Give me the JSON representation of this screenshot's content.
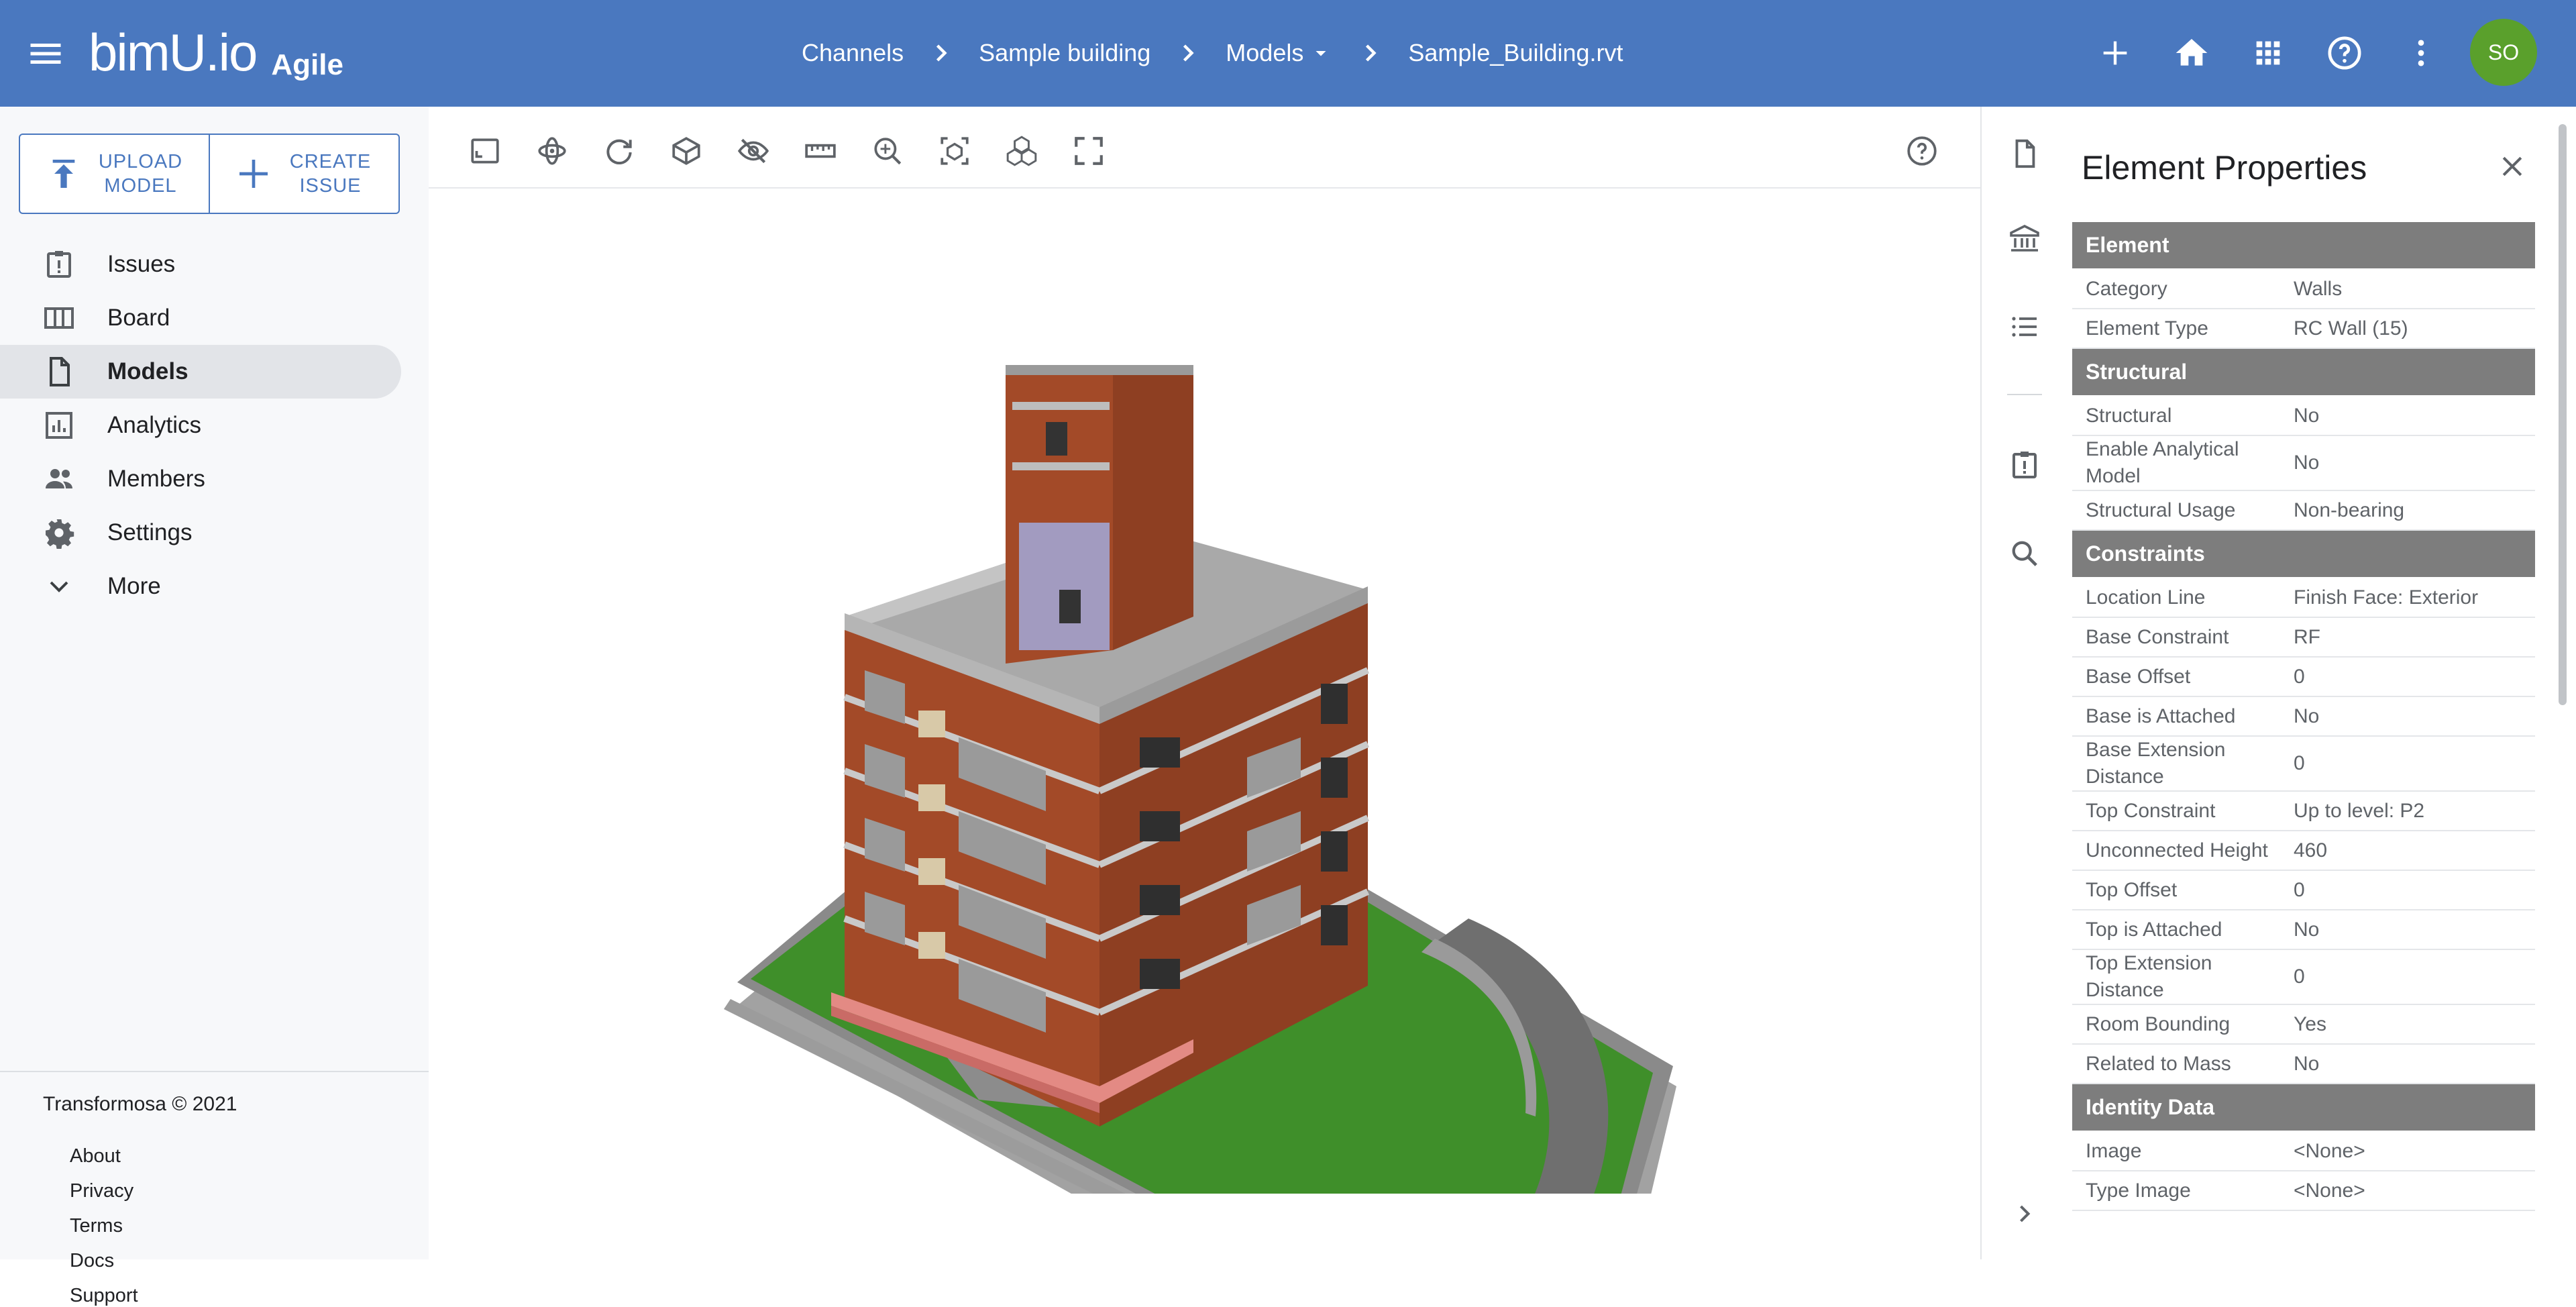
{
  "app": {
    "logo": "bimU.io",
    "edition": "Agile"
  },
  "header": {
    "breadcrumbs": [
      {
        "label": "Channels"
      },
      {
        "label": "Sample building"
      },
      {
        "label": "Models"
      },
      {
        "label": "Sample_Building.rvt"
      }
    ],
    "icons": [
      "add-icon",
      "home-icon",
      "apps-grid-icon",
      "help-icon",
      "more-vert-icon"
    ],
    "avatar_initials": "SO"
  },
  "sidebar": {
    "upload_label": "UPLOAD MODEL",
    "create_issue_label": "CREATE ISSUE",
    "items": [
      {
        "label": "Issues",
        "icon": "issue-icon"
      },
      {
        "label": "Board",
        "icon": "board-icon"
      },
      {
        "label": "Models",
        "icon": "document-icon",
        "active": true
      },
      {
        "label": "Analytics",
        "icon": "analytics-icon"
      },
      {
        "label": "Members",
        "icon": "members-icon"
      },
      {
        "label": "Settings",
        "icon": "gear-icon"
      },
      {
        "label": "More",
        "icon": "chevron-down-icon"
      }
    ],
    "copyright": "Transformosa © 2021",
    "footer_links": [
      "About",
      "Privacy",
      "Terms",
      "Docs",
      "Support"
    ]
  },
  "viewer": {
    "tools": [
      "fit-view-icon",
      "orbit-icon",
      "reset-view-icon",
      "section-box-icon",
      "hide-icon",
      "measure-icon",
      "zoom-icon",
      "isolate-icon",
      "layers-icon",
      "fullscreen-icon"
    ]
  },
  "properties": {
    "title": "Element Properties",
    "sections": [
      {
        "name": "Element",
        "rows": [
          {
            "key": "Category",
            "value": "Walls"
          },
          {
            "key": "Element Type",
            "value": "RC Wall (15)"
          }
        ]
      },
      {
        "name": "Structural",
        "rows": [
          {
            "key": "Structural",
            "value": "No"
          },
          {
            "key": "Enable Analytical Model",
            "value": "No"
          },
          {
            "key": "Structural Usage",
            "value": "Non-bearing"
          }
        ]
      },
      {
        "name": "Constraints",
        "rows": [
          {
            "key": "Location Line",
            "value": "Finish Face: Exterior"
          },
          {
            "key": "Base Constraint",
            "value": "RF"
          },
          {
            "key": "Base Offset",
            "value": "0"
          },
          {
            "key": "Base is Attached",
            "value": "No"
          },
          {
            "key": "Base Extension Distance",
            "value": "0"
          },
          {
            "key": "Top Constraint",
            "value": "Up to level: P2"
          },
          {
            "key": "Unconnected Height",
            "value": "460"
          },
          {
            "key": "Top Offset",
            "value": "0"
          },
          {
            "key": "Top is Attached",
            "value": "No"
          },
          {
            "key": "Top Extension Distance",
            "value": "0"
          },
          {
            "key": "Room Bounding",
            "value": "Yes"
          },
          {
            "key": "Related to Mass",
            "value": "No"
          }
        ]
      },
      {
        "name": "Identity Data",
        "rows": [
          {
            "key": "Image",
            "value": "<None>"
          },
          {
            "key": "Type Image",
            "value": "<None>"
          }
        ]
      }
    ]
  },
  "colors": {
    "header": "#4a78bf",
    "avatar": "#5aa02c",
    "section_header": "#7d7d7d",
    "brick": "#a34a28",
    "grass": "#3f8f2a"
  }
}
